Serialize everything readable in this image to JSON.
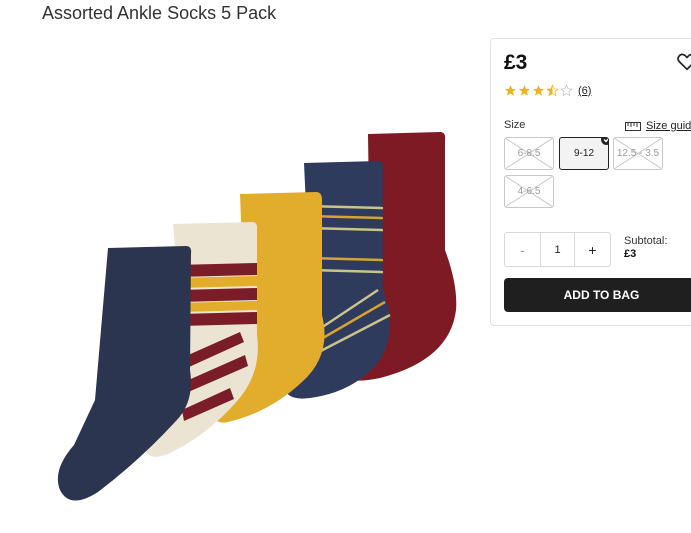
{
  "product": {
    "title": "Assorted Ankle Socks 5 Pack",
    "image_alt": "Five assorted ankle socks"
  },
  "panel": {
    "price": "£3",
    "rating": {
      "value": 3.5,
      "max": 5,
      "review_count": "(6)"
    },
    "size_label": "Size",
    "size_guide_label": "Size guid",
    "sizes": [
      {
        "label": "6-8.5",
        "available": false,
        "selected": false
      },
      {
        "label": "9-12",
        "available": true,
        "selected": true
      },
      {
        "label": "12.5 - 3.5",
        "available": false,
        "selected": false
      },
      {
        "label": "4-6.5",
        "available": false,
        "selected": false
      }
    ],
    "quantity": {
      "minus": "-",
      "value": "1",
      "plus": "+"
    },
    "subtotal_label": "Subtotal:",
    "subtotal_value": "£3",
    "add_to_bag_label": "ADD TO BAG"
  },
  "colors": {
    "navy": "#2b3550",
    "cream": "#ece4d2",
    "mustard": "#e2ad2c",
    "navy_striped": "#334062",
    "burgundy": "#7e1a24",
    "star": "#f1b01d",
    "button_bg": "#1f1f1f"
  },
  "icons": {
    "favorite": "heart-outline-icon",
    "size_guide": "ruler-icon",
    "selected_size": "check-icon"
  }
}
